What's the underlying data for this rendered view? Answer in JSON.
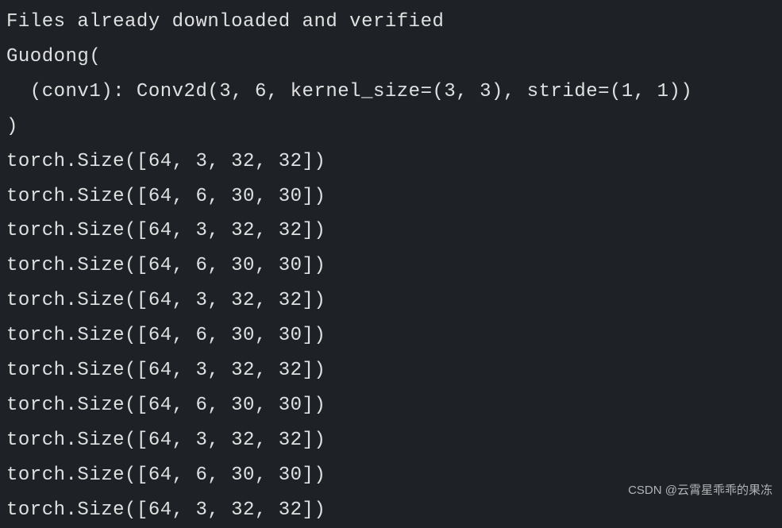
{
  "terminal": {
    "lines": [
      "Files already downloaded and verified",
      "Guodong(",
      "  (conv1): Conv2d(3, 6, kernel_size=(3, 3), stride=(1, 1))",
      ")",
      "torch.Size([64, 3, 32, 32])",
      "torch.Size([64, 6, 30, 30])",
      "torch.Size([64, 3, 32, 32])",
      "torch.Size([64, 6, 30, 30])",
      "torch.Size([64, 3, 32, 32])",
      "torch.Size([64, 6, 30, 30])",
      "torch.Size([64, 3, 32, 32])",
      "torch.Size([64, 6, 30, 30])",
      "torch.Size([64, 3, 32, 32])",
      "torch.Size([64, 6, 30, 30])",
      "torch.Size([64, 3, 32, 32])"
    ]
  },
  "watermark": {
    "text": "CSDN @云霄星乖乖的果冻"
  }
}
